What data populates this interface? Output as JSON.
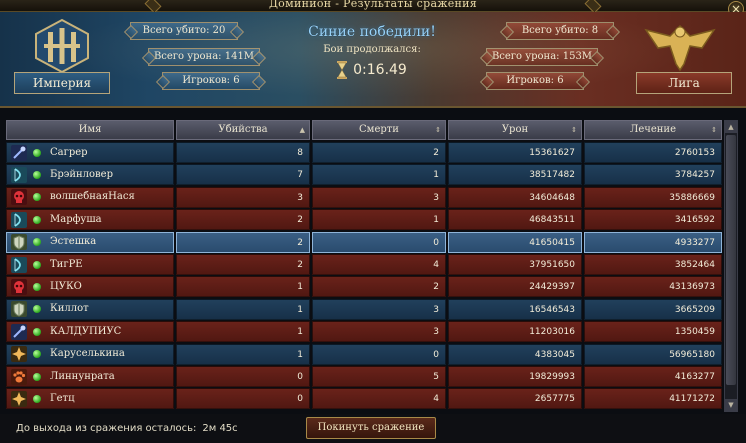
{
  "window": {
    "title": "Доминион - Результаты сражения",
    "close": "×"
  },
  "banner": {
    "left": {
      "faction": "Империя",
      "total_kills": "Всего убито: 20",
      "total_damage": "Всего урона: 141M",
      "players": "Игроков: 6"
    },
    "right": {
      "faction": "Лига",
      "total_kills": "Всего убито: 8",
      "total_damage": "Всего урона: 153M",
      "players": "Игроков: 6"
    },
    "result": "Синие победили!",
    "duration_label": "Бои продолжался:",
    "duration": "0:16.49"
  },
  "table": {
    "headers": [
      "Имя",
      "Убийства",
      "Смерти",
      "Урон",
      "Лечение"
    ],
    "rows": [
      {
        "team": "blue",
        "cls": "staff",
        "name": "Сагрер",
        "kills": "8",
        "deaths": "2",
        "damage": "15361627",
        "heal": "2760153"
      },
      {
        "team": "blue",
        "cls": "bow",
        "name": "Брэйнловер",
        "kills": "7",
        "deaths": "1",
        "damage": "38517482",
        "heal": "3784257"
      },
      {
        "team": "red",
        "cls": "skull",
        "name": "волшебнаяНася",
        "kills": "3",
        "deaths": "3",
        "damage": "34604648",
        "heal": "35886669"
      },
      {
        "team": "red",
        "cls": "bow",
        "name": "Марфуша",
        "kills": "2",
        "deaths": "1",
        "damage": "46843511",
        "heal": "3416592"
      },
      {
        "team": "me",
        "cls": "shield",
        "name": "Эстешка",
        "kills": "2",
        "deaths": "0",
        "damage": "41650415",
        "heal": "4933277"
      },
      {
        "team": "red",
        "cls": "bow",
        "name": "ТигРЕ",
        "kills": "2",
        "deaths": "4",
        "damage": "37951650",
        "heal": "3852464"
      },
      {
        "team": "red",
        "cls": "skull",
        "name": "ЦУКО",
        "kills": "1",
        "deaths": "2",
        "damage": "24429397",
        "heal": "43136973"
      },
      {
        "team": "blue",
        "cls": "shield",
        "name": "Киллот",
        "kills": "1",
        "deaths": "3",
        "damage": "16546543",
        "heal": "3665209"
      },
      {
        "team": "red",
        "cls": "staff",
        "name": "КАЛДУПИУС",
        "kills": "1",
        "deaths": "3",
        "damage": "11203016",
        "heal": "1350459"
      },
      {
        "team": "blue",
        "cls": "cross",
        "name": "Каруселькина",
        "kills": "1",
        "deaths": "0",
        "damage": "4383045",
        "heal": "56965180"
      },
      {
        "team": "red",
        "cls": "paw",
        "name": "Линнунрата",
        "kills": "0",
        "deaths": "5",
        "damage": "19829993",
        "heal": "4163277"
      },
      {
        "team": "red",
        "cls": "cross",
        "name": "Гетц",
        "kills": "0",
        "deaths": "4",
        "damage": "2657775",
        "heal": "41171272"
      }
    ]
  },
  "footer": {
    "exit_label": "До выхода из сражения осталось:",
    "exit_time": "2м 45с",
    "leave_button": "Покинуть сражение"
  },
  "colors": {
    "blue_row": "#21405c",
    "red_row": "#6a221a",
    "selected_row": "#3a5f84",
    "gold": "#a88a48"
  },
  "icons": {
    "staff": "staff-icon",
    "bow": "bow-icon",
    "skull": "skull-icon",
    "shield": "shield-icon",
    "cross": "cross-icon",
    "paw": "paw-icon"
  }
}
